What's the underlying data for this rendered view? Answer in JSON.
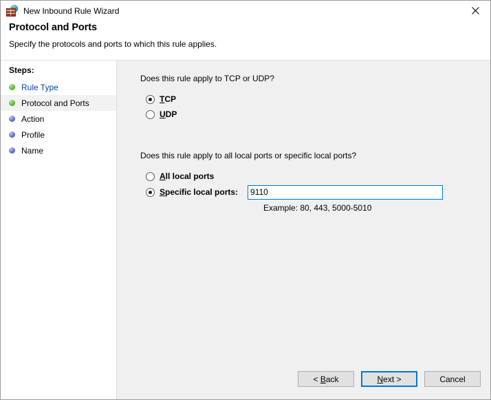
{
  "window": {
    "title": "New Inbound Rule Wizard",
    "icon": "firewall-icon",
    "close_label": "✕"
  },
  "header": {
    "title": "Protocol and Ports",
    "subtitle": "Specify the protocols and ports to which this rule applies."
  },
  "sidebar": {
    "label": "Steps:",
    "items": [
      {
        "label": "Rule Type",
        "state": "link",
        "bullet": "green"
      },
      {
        "label": "Protocol and Ports",
        "state": "current",
        "bullet": "green"
      },
      {
        "label": "Action",
        "state": "pending",
        "bullet": "blue"
      },
      {
        "label": "Profile",
        "state": "pending",
        "bullet": "blue"
      },
      {
        "label": "Name",
        "state": "pending",
        "bullet": "blue"
      }
    ]
  },
  "main": {
    "protocol": {
      "question": "Does this rule apply to TCP or UDP?",
      "options": [
        {
          "label": "TCP",
          "accelerator": "T",
          "selected": true
        },
        {
          "label": "UDP",
          "accelerator": "U",
          "selected": false
        }
      ]
    },
    "ports": {
      "question": "Does this rule apply to all local ports or specific local ports?",
      "all_label": "All local ports",
      "all_accelerator": "A",
      "all_selected": false,
      "specific_label": "Specific local ports:",
      "specific_accelerator": "S",
      "specific_selected": true,
      "port_value": "9110",
      "example": "Example: 80, 443, 5000-5010"
    }
  },
  "footer": {
    "back_label": "< Back",
    "next_label": "Next >",
    "cancel_label": "Cancel"
  },
  "colors": {
    "accent": "#0078d7",
    "link": "#0645a8",
    "panel": "#f0f0f0",
    "step_done": "#6ac33f",
    "step_pending": "#6d7fd2"
  }
}
